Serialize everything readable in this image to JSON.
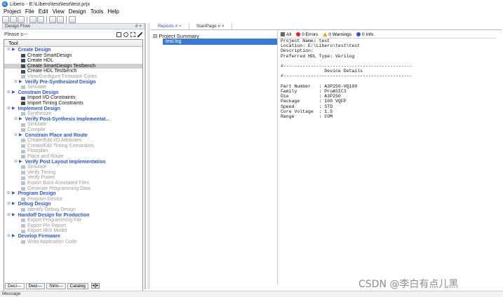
{
  "window": {
    "title": "Libero - E:\\Libero\\test\\test\\test.prjx"
  },
  "menu": [
    "Project",
    "File",
    "Edit",
    "View",
    "Design",
    "Tools",
    "Help"
  ],
  "toolbar_icons": [
    "new-icon",
    "open-icon",
    "save-icon",
    "undo-icon",
    "redo-icon",
    "view-icon",
    "export-icon",
    "edit-icon"
  ],
  "design_flow": {
    "header": "Design Flow",
    "header_controls": "# ×",
    "please_text": "Please s---",
    "tool_column": "Tool",
    "items": [
      {
        "label": "Create Design",
        "kind": "head"
      },
      {
        "label": "Create SmartDesign",
        "kind": "ok"
      },
      {
        "label": "Create HDL",
        "kind": "ok"
      },
      {
        "label": "Create SmartDesign Testbench",
        "kind": "sel"
      },
      {
        "label": "Create HDL Testbench",
        "kind": "ok"
      },
      {
        "label": "View/Configure Firmware Cores",
        "kind": "dis"
      },
      {
        "label": "Verify Pre-Synthesized Design",
        "kind": "subhead"
      },
      {
        "label": "Simulate",
        "kind": "dis"
      },
      {
        "label": "Constrain Design",
        "kind": "head"
      },
      {
        "label": "Import I/O Constraints",
        "kind": "ok"
      },
      {
        "label": "Import Timing Constraints",
        "kind": "ok"
      },
      {
        "label": "Implement Design",
        "kind": "head"
      },
      {
        "label": "Synthesize",
        "kind": "dis"
      },
      {
        "label": "Verify Post-Synthesis Implementat...",
        "kind": "subhead"
      },
      {
        "label": "Simulate",
        "kind": "dis"
      },
      {
        "label": "Compile",
        "kind": "dis"
      },
      {
        "label": "Constrain Place and Route",
        "kind": "subhead"
      },
      {
        "label": "Create/Edit I/O Attributes",
        "kind": "dis"
      },
      {
        "label": "Create/Edit Timing Constraints",
        "kind": "dis"
      },
      {
        "label": "Floorplan",
        "kind": "dis"
      },
      {
        "label": "Place and Route",
        "kind": "dis"
      },
      {
        "label": "Verify Post Layout Implementation",
        "kind": "subhead"
      },
      {
        "label": "Simulate",
        "kind": "dis"
      },
      {
        "label": "Verify Timing",
        "kind": "dis"
      },
      {
        "label": "Verify Power",
        "kind": "dis"
      },
      {
        "label": "Export Back Annotated Files",
        "kind": "dis"
      },
      {
        "label": "Generate Programming Data",
        "kind": "dis"
      },
      {
        "label": "Program Design",
        "kind": "head"
      },
      {
        "label": "Program Device",
        "kind": "dis"
      },
      {
        "label": "Debug Design",
        "kind": "head"
      },
      {
        "label": "Identify Debug Design",
        "kind": "dis"
      },
      {
        "label": "Handoff Design for Production",
        "kind": "head"
      },
      {
        "label": "Export Programming File",
        "kind": "dis"
      },
      {
        "label": "Export Pin Report",
        "kind": "dis"
      },
      {
        "label": "Export IBIS Model",
        "kind": "dis"
      },
      {
        "label": "Develop Firmware",
        "kind": "head"
      },
      {
        "label": "Write Application Code",
        "kind": "dis"
      }
    ]
  },
  "bottom_tabs": [
    "Deci---",
    "Deci---",
    "Stim---",
    "Catalog"
  ],
  "right_tabs": [
    {
      "label": "Reports  # ×",
      "active": true
    },
    {
      "label": "StartPage # ×",
      "active": false
    }
  ],
  "summary": {
    "root": "Project Summary",
    "child": "test.log"
  },
  "log_filters": [
    {
      "icon": "all-icon",
      "label": "All"
    },
    {
      "icon": "error-icon",
      "label": "0 Errors"
    },
    {
      "icon": "warning-icon",
      "label": "0 Warnings"
    },
    {
      "icon": "info-icon",
      "label": "0 Info"
    }
  ],
  "log_lines": [
    "Project Name: test",
    "Location: E:\\Libero\\test\\test",
    "Description:",
    "Preferred HDL Type: Verilog",
    "",
    "#-----------------------------------------------",
    "                Device Details",
    "#-----------------------------------------------",
    "",
    "Part Number   : A3P250-VQ100",
    "Family        : ProASIC3",
    "Die           : A3P250",
    "Package       : 100 VQFP",
    "Speed         : STD",
    "Core Voltage  : 1.5",
    "Range         : COM"
  ],
  "status": "Message",
  "watermark": "CSDN @李白有点儿黑"
}
